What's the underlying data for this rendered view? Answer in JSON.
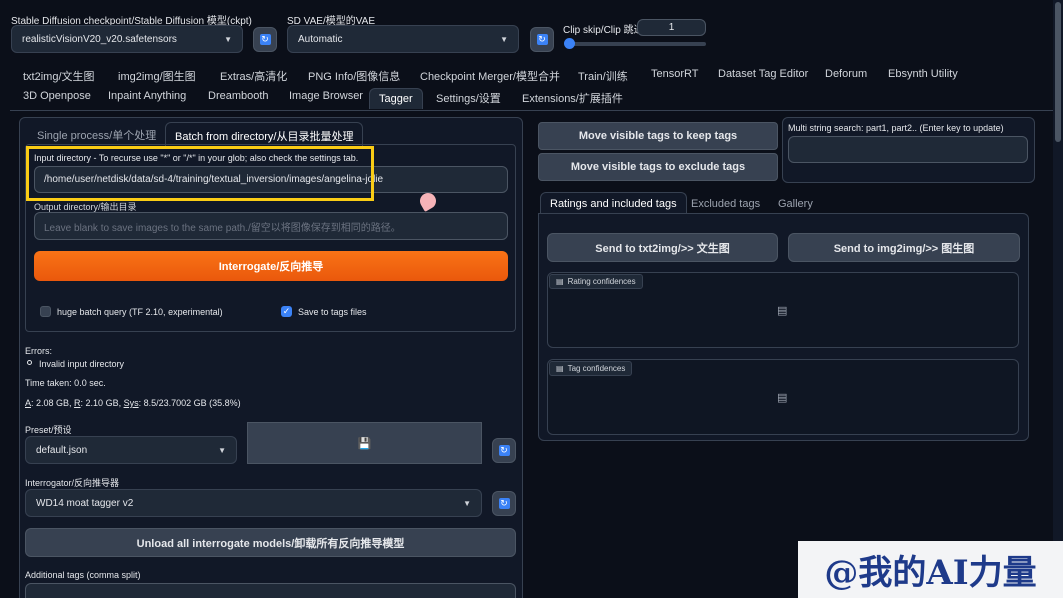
{
  "top": {
    "checkpoint_label": "Stable Diffusion checkpoint/Stable Diffusion 模型(ckpt)",
    "checkpoint_value": "realisticVisionV20_v20.safetensors",
    "vae_label": "SD VAE/模型的VAE",
    "vae_value": "Automatic",
    "clip_label": "Clip skip/Clip 跳过层",
    "clip_value": "1",
    "clip_fraction": 0.0
  },
  "tabs_row1": [
    "txt2img/文生图",
    "img2img/图生图",
    "Extras/高清化",
    "PNG Info/图像信息",
    "Checkpoint Merger/模型合并",
    "Train/训练",
    "TensorRT",
    "Dataset Tag Editor",
    "Deforum",
    "Ebsynth Utility"
  ],
  "tabs_row2": [
    "3D Openpose",
    "Inpaint Anything",
    "Dreambooth",
    "Image Browser",
    "Tagger",
    "Settings/设置",
    "Extensions/扩展插件"
  ],
  "left": {
    "subtab_single": "Single process/单个处理",
    "subtab_batch": "Batch from directory/从目录批量处理",
    "input_dir_label": "Input directory - To recurse use \"*\" or \"/*\" in your glob; also check the settings tab.",
    "input_dir_value": "/home/user/netdisk/data/sd-4/training/textual_inversion/images/angelina-jolie",
    "output_dir_label": "Output directory/输出目录",
    "output_dir_placeholder": "Leave blank to save images to the same path./留空以将图像保存到相同的路径。",
    "interrogate_btn": "Interrogate/反向推导",
    "huge_batch_label": "huge batch query (TF 2.10, experimental)",
    "save_tags_label": "Save to tags files",
    "errors_title": "Errors:",
    "error_item": "Invalid input directory",
    "time_taken": "Time taken: 0.0 sec.",
    "mem_a_key": "A",
    "mem_a_val": ": 2.08 GB, ",
    "mem_r_key": "R",
    "mem_r_val": ": 2.10 GB, ",
    "mem_s_key": "Sys",
    "mem_s_val": ": 8.5/23.7002 GB (35.8%)",
    "preset_label": "Preset/预设",
    "preset_value": "default.json",
    "interrogator_label": "Interrogator/反向推导器",
    "interrogator_value": "WD14 moat tagger v2",
    "unload_btn": "Unload all interrogate models/卸载所有反向推导模型",
    "additional_tags_label": "Additional tags (comma split)"
  },
  "right": {
    "keep_btn": "Move visible tags to keep tags",
    "exclude_btn": "Move visible tags to exclude tags",
    "multi_search_label": "Multi string search: part1, part2.. (Enter key to update)",
    "tab_ratings": "Ratings and included tags",
    "tab_excluded": "Excluded tags",
    "tab_gallery": "Gallery",
    "send_txt2img": "Send to txt2img/>> 文生图",
    "send_img2img": "Send to img2img/>> 图生图",
    "rating_conf": "Rating confidences",
    "tag_conf": "Tag confidences"
  },
  "watermark": "@我的AI力量"
}
